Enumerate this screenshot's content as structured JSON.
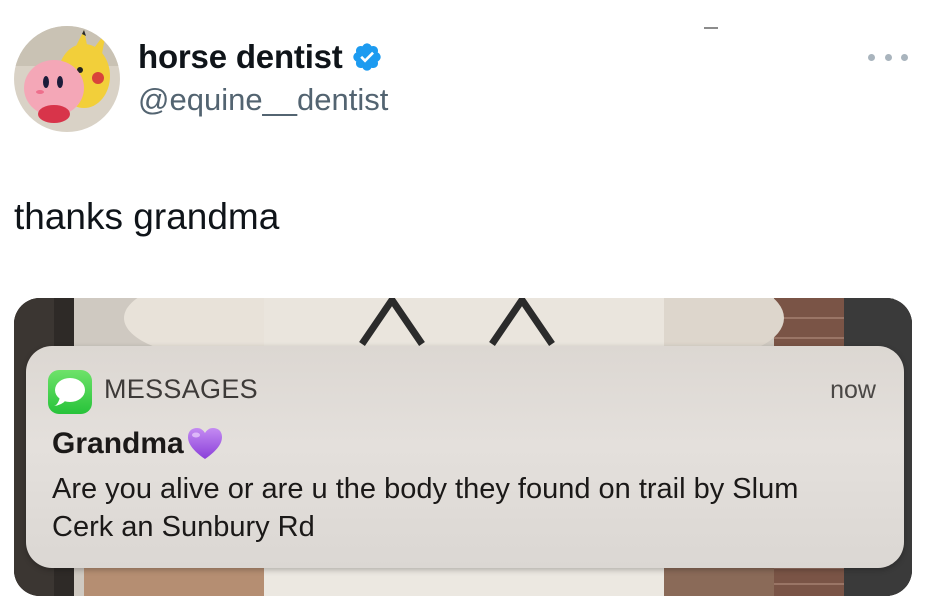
{
  "tweet": {
    "display_name": "horse dentist",
    "handle": "@equine__dentist",
    "text": "thanks grandma",
    "verified": true,
    "more_icon": "ellipsis-icon",
    "verified_color": "#1d9bf0"
  },
  "notification": {
    "app_name": "MESSAGES",
    "timestamp": "now",
    "sender": "Grandma",
    "sender_emoji": "purple-heart",
    "message": "Are you alive or are u the body they found on trail by Slum Cerk an Sunbury Rd",
    "app_icon": "messages-icon",
    "app_icon_color": "#34c759"
  }
}
